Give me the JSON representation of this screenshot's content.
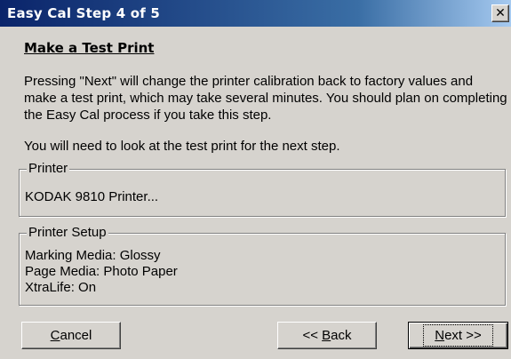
{
  "window": {
    "title": "Easy Cal Step 4 of 5",
    "close_glyph": "✕"
  },
  "content": {
    "heading": "Make a Test Print",
    "paragraph1": "Pressing \"Next\" will change the printer calibration back to factory values and make a test print, which may take several minutes.  You should plan on completing the Easy Cal process if you take this step.",
    "paragraph2": "You will need to look at the test print for the next step."
  },
  "printer_group": {
    "label": "Printer",
    "value": "KODAK 9810 Printer..."
  },
  "setup_group": {
    "label": "Printer Setup",
    "marking_media": "Marking Media: Glossy",
    "page_media": "Page Media: Photo Paper",
    "xtralife": "XtraLife: On"
  },
  "buttons": {
    "cancel_accel": "C",
    "cancel_rest": "ancel",
    "back_prefix": "<< ",
    "back_accel": "B",
    "back_rest": "ack",
    "next_accel": "N",
    "next_rest": "ext >>"
  },
  "colors": {
    "title_bar_start": "#0a246a",
    "title_bar_end": "#a6caf0",
    "dialog_face": "#d6d3ce"
  }
}
